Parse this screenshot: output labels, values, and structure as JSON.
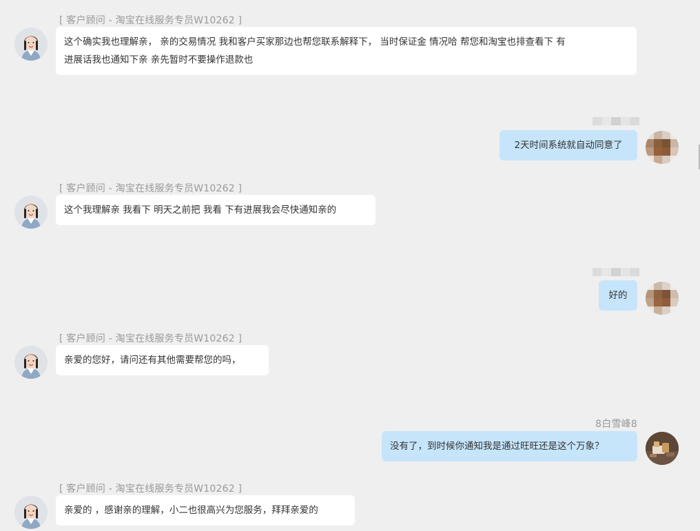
{
  "messages": [
    {
      "side": "in",
      "sender": "[ 客户顾问  -  淘宝在线服务专员W10262 ]",
      "lines": [
        "这个确实我也理解亲， 亲的交易情况 我和客户买家那边也帮您联系解释下， 当时保证金 情况哈 帮您和淘宝也排查看下 有",
        "进展话我也通知下亲 亲先暂时不要操作退款也"
      ]
    },
    {
      "side": "out",
      "sender": "",
      "lines": [
        "2天时间系统就自动同意了"
      ]
    },
    {
      "side": "in",
      "sender": "[ 客户顾问  -  淘宝在线服务专员W10262 ]",
      "lines": [
        "这个我理解亲 我看下 明天之前把 我看 下有进展我会尽快通知亲的"
      ]
    },
    {
      "side": "out",
      "sender": "",
      "lines": [
        "好的"
      ]
    },
    {
      "side": "in",
      "sender": "[ 客户顾问  -  淘宝在线服务专员W10262 ]",
      "lines": [
        "亲爱的您好，请问还有其他需要帮您的吗，"
      ]
    },
    {
      "side": "out",
      "sender": "8白雪峰8",
      "lines": [
        "没有了，到时候你通知我是通过旺旺还是这个万象？"
      ]
    },
    {
      "side": "in",
      "sender": "[ 客户顾问  -  淘宝在线服务专员W10262 ]",
      "lines": [
        "亲爱的 ，感谢亲的理解，小二也很高兴为您服务，拜拜亲爱的"
      ]
    }
  ],
  "icons": {
    "agent_avatar": "agent-avatar-icon",
    "user_avatar": "user-avatar-icon"
  },
  "colors": {
    "background": "#efefef",
    "incoming_bubble": "#ffffff",
    "outgoing_bubble": "#c6e5fb",
    "sender_text": "#999999",
    "message_text": "#333333"
  }
}
